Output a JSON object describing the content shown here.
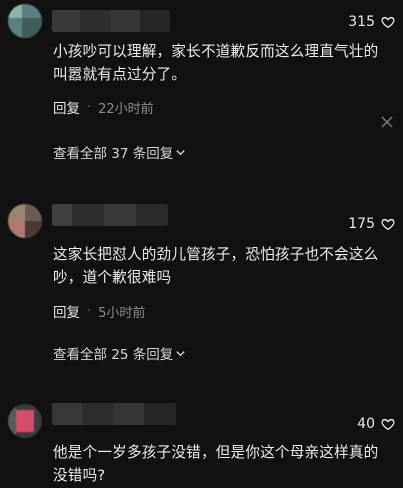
{
  "comments": [
    {
      "likes": "315",
      "text": "小孩吵可以理解，家长不道歉反而这么理直气壮的叫嚣就有点过分了。",
      "reply_label": "回复",
      "time": "22小时前",
      "view_replies": "查看全部 37 条回复"
    },
    {
      "likes": "175",
      "text": "这家长把怼人的劲儿管孩子，恐怕孩子也不会这么吵，道个歉很难吗",
      "reply_label": "回复",
      "time": "5小时前",
      "view_replies": "查看全部 25 条回复"
    },
    {
      "likes": "40",
      "text": "他是个一岁多孩子没错，但是你这个母亲这样真的没错吗?"
    }
  ],
  "meta_separator": "·",
  "icons": {
    "like": "heart-outline-icon",
    "dismiss": "close-icon",
    "expand": "chevron-down-icon"
  },
  "colors": {
    "background": "#121212",
    "text": "#ececec",
    "muted": "#8a8a8a"
  }
}
